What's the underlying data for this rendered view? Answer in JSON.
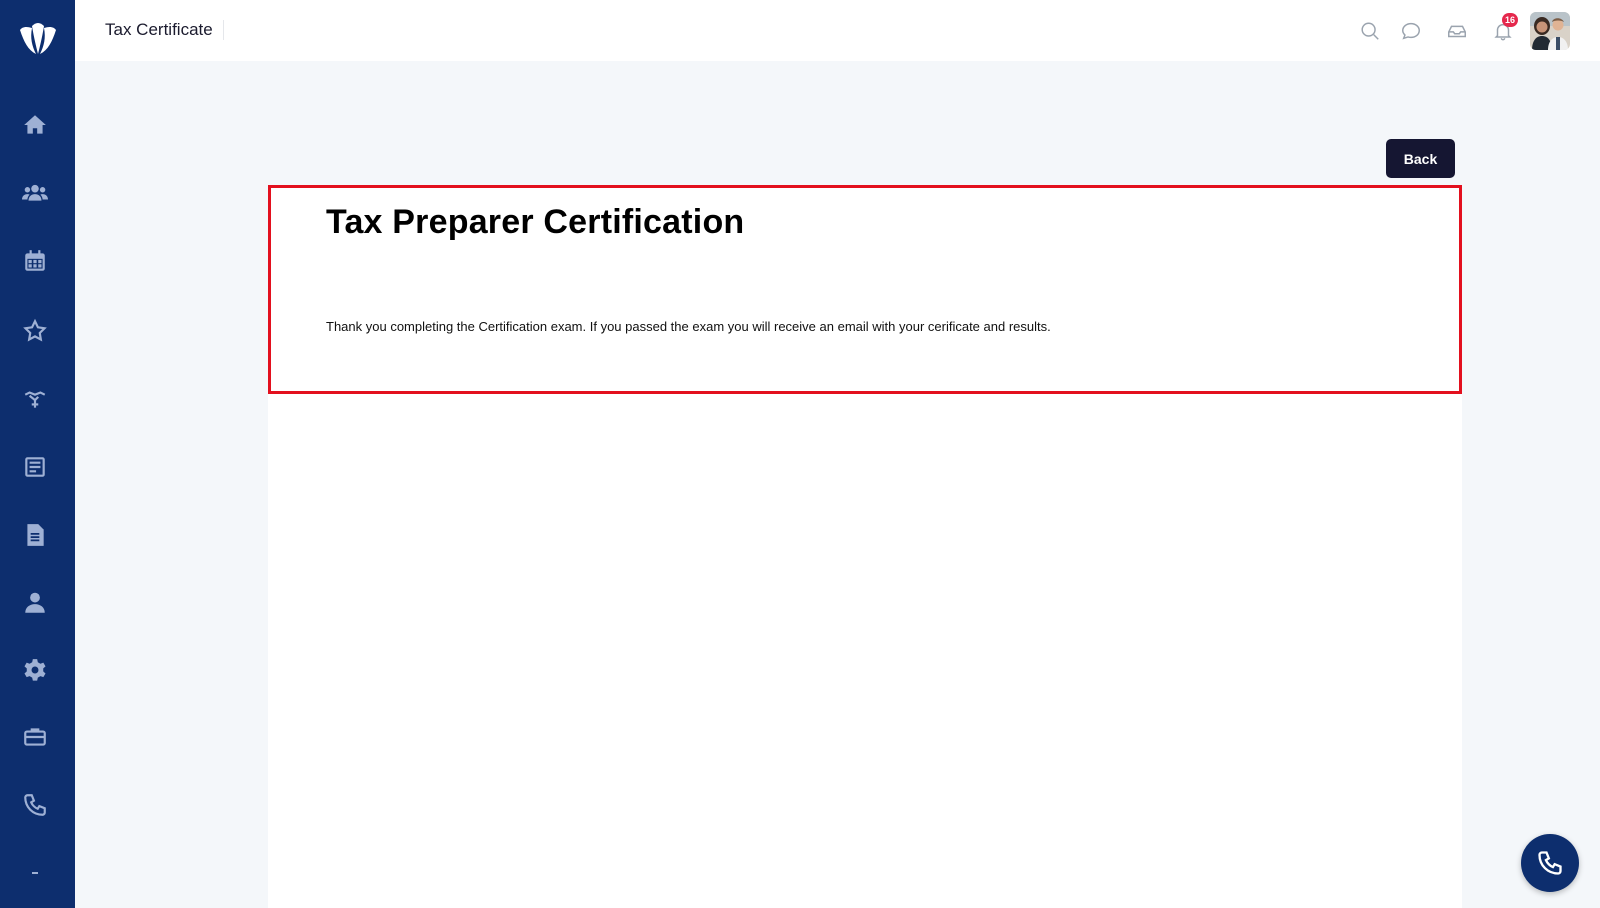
{
  "header": {
    "title": "Tax Certificate",
    "notification_count": "16"
  },
  "sidebar": {
    "items": [
      {
        "icon": "home-icon"
      },
      {
        "icon": "users-icon"
      },
      {
        "icon": "calendar-icon"
      },
      {
        "icon": "star-icon"
      },
      {
        "icon": "handshake-icon"
      },
      {
        "icon": "newspaper-icon"
      },
      {
        "icon": "document-icon"
      },
      {
        "icon": "user-icon"
      },
      {
        "icon": "gear-icon"
      },
      {
        "icon": "briefcase-icon"
      },
      {
        "icon": "phone-icon"
      }
    ]
  },
  "main": {
    "back_label": "Back",
    "certification_title": "Tax Preparer Certification",
    "message": "Thank you completing the Certification exam. If you passed the exam you will receive an email with your cerificate and results."
  },
  "colors": {
    "sidebar_bg": "#0d2e6e",
    "highlight_border": "#e3101e",
    "button_bg": "#151632",
    "badge_bg": "#e5284d"
  }
}
